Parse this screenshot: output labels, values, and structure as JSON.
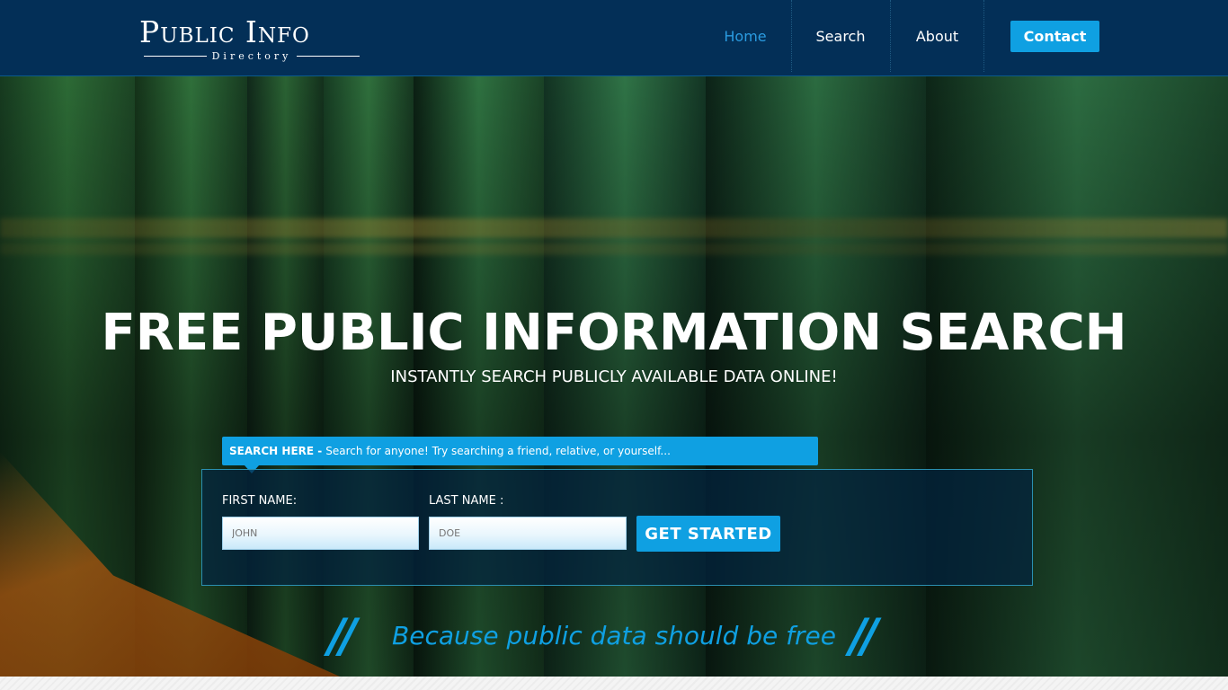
{
  "logo": {
    "main": "Public Info",
    "sub": "Directory"
  },
  "nav": {
    "items": [
      {
        "label": "Home",
        "active": true
      },
      {
        "label": "Search",
        "active": false
      },
      {
        "label": "About",
        "active": false
      }
    ],
    "contact_label": "Contact"
  },
  "hero": {
    "title": "FREE PUBLIC INFORMATION SEARCH",
    "subtitle": "INSTANTLY SEARCH PUBLICLY AVAILABLE DATA ONLINE!"
  },
  "search": {
    "tab_bold": "SEARCH HERE -",
    "tab_text": "Search for anyone! Try searching a friend, relative, or yourself...",
    "first_name_label": "FIRST NAME:",
    "first_name_placeholder": "JOHN",
    "last_name_label": "LAST NAME :",
    "last_name_placeholder": "DOE",
    "button_label": "GET STARTED"
  },
  "slogan": {
    "text": "Because public data should be free",
    "quote_left": "//",
    "quote_right": "//"
  },
  "colors": {
    "header_bg": "#032f57",
    "accent": "#0fa0e2",
    "active_nav": "#2a9be0"
  }
}
